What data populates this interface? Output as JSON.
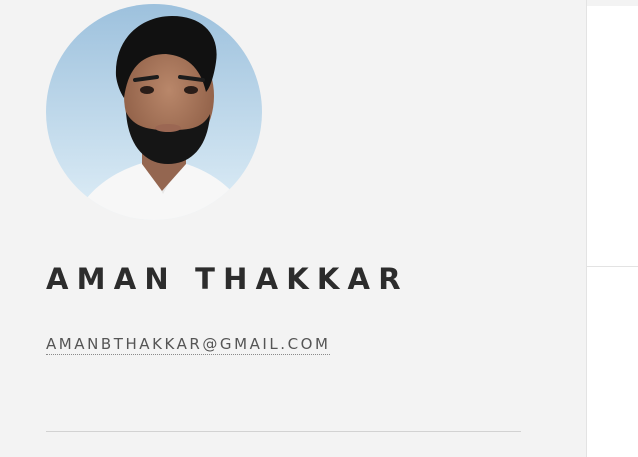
{
  "profile": {
    "name": "AMAN THAKKAR",
    "email": "AMANBTHAKKAR@GMAIL.COM"
  },
  "colors": {
    "background": "#f3f3f3",
    "name_text": "#2c2c2c",
    "email_text": "#555555",
    "divider": "#d2d2d2",
    "right_panel": "#ffffff"
  },
  "icons": {
    "avatar": "profile-photo"
  }
}
